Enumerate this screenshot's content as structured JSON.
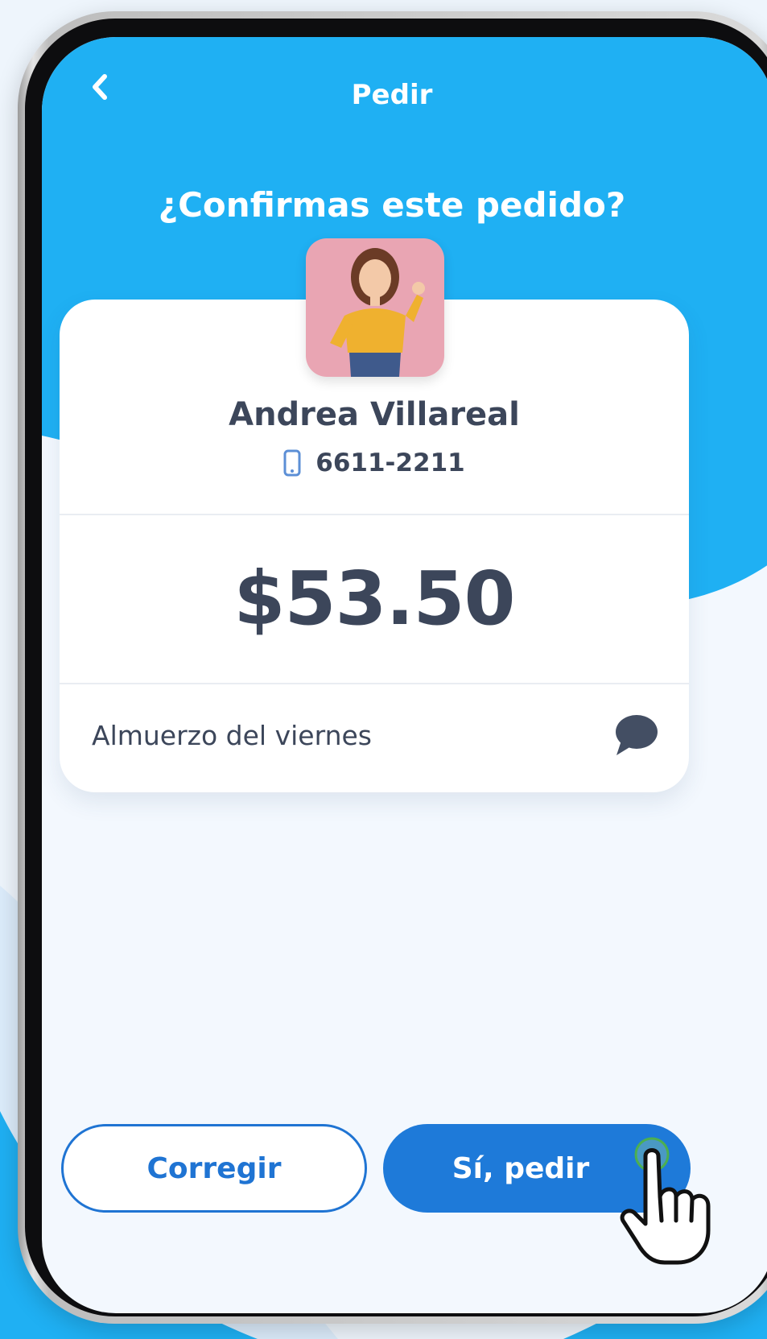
{
  "header": {
    "title": "Pedir",
    "back_icon": "chevron-left-icon"
  },
  "confirm": {
    "question": "¿Confirmas este pedido?"
  },
  "recipient": {
    "name": "Andrea Villareal",
    "phone": "6611-2211",
    "phone_icon": "smartphone-icon",
    "avatar": "avatar-photo"
  },
  "order": {
    "amount": "$53.50",
    "note": "Almuerzo del viernes",
    "note_icon": "comment-bubble-icon"
  },
  "actions": {
    "secondary_label": "Corregir",
    "primary_label": "Sí, pedir"
  },
  "colors": {
    "header_blue": "#1fb0f3",
    "button_blue": "#1e7ad9",
    "text_dark": "#3c465a",
    "background": "#f3f8fe"
  }
}
